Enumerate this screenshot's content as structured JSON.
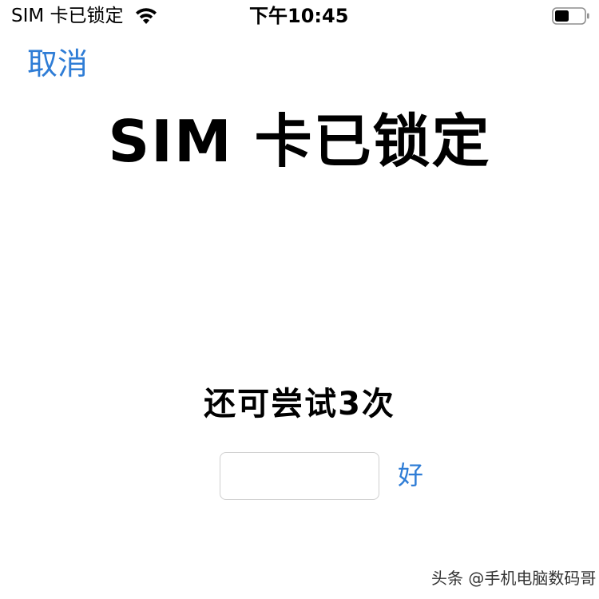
{
  "status_bar": {
    "carrier": "SIM 卡已锁定",
    "time": "下午10:45"
  },
  "nav": {
    "cancel_label": "取消"
  },
  "main": {
    "title": "SIM 卡已锁定",
    "attempts_text": "还可尝试3次",
    "pin_input": {
      "value": "",
      "placeholder": ""
    },
    "ok_label": "好"
  },
  "watermark": {
    "text": "头条 @手机电脑数码哥"
  },
  "colors": {
    "accent": "#2f7dd6",
    "text": "#000000",
    "background": "#ffffff",
    "input_border": "#cfcfcf"
  },
  "icons": {
    "wifi": "wifi-icon",
    "battery": "battery-icon"
  }
}
